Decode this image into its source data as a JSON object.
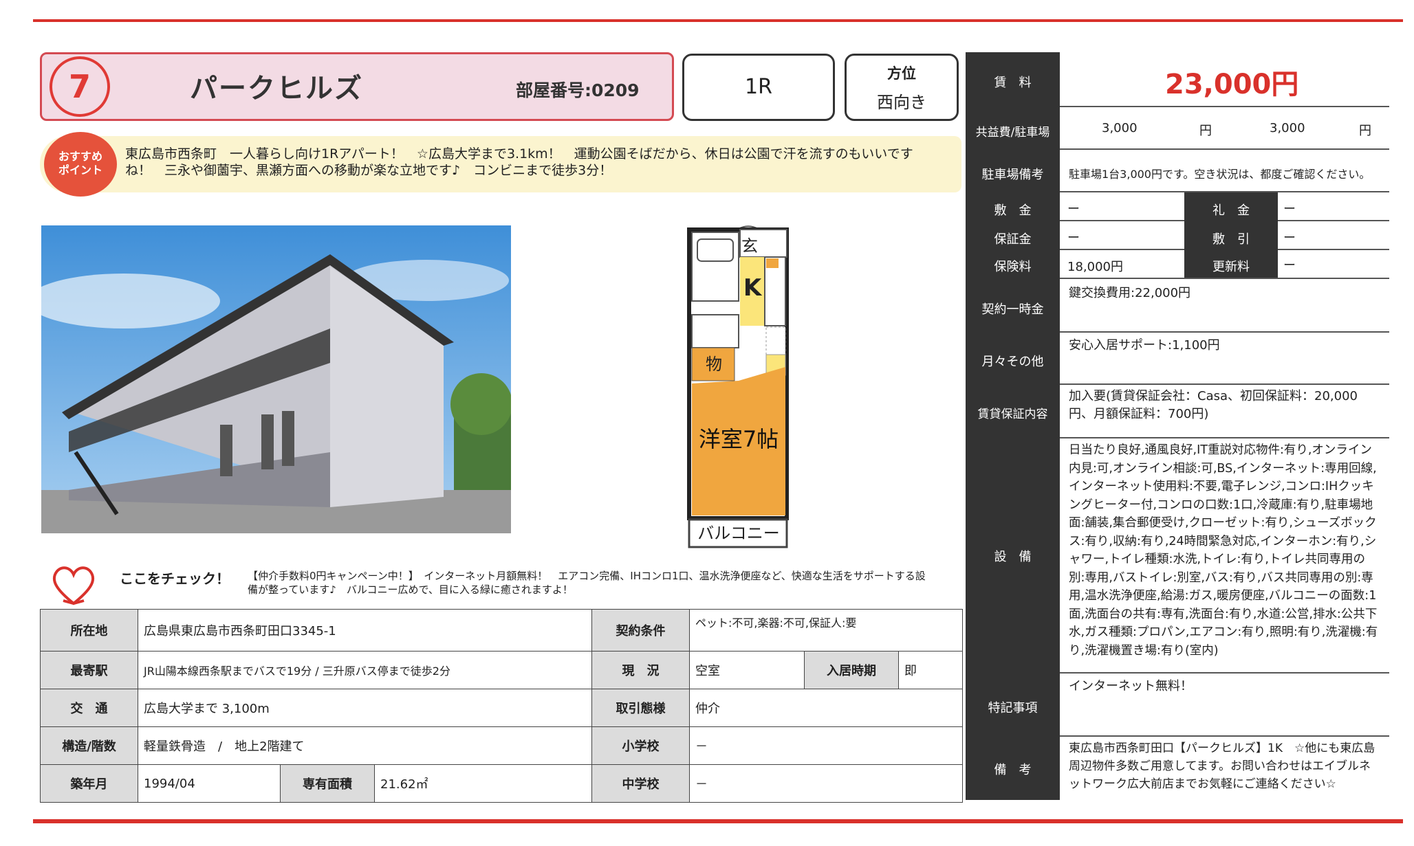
{
  "header": {
    "number": "7",
    "property_name": "パークヒルズ",
    "room_number_label": "部屋番号:0209",
    "layout": "1R",
    "direction_label": "方位",
    "direction_value": "西向き"
  },
  "recommend": {
    "badge_line1": "おすすめ",
    "badge_line2": "ポイント",
    "text": "東広島市西条町　一人暮らし向け1Rアパート！　☆広島大学まで3.1km！　運動公園そばだから、休日は公園で汗を流すのもいいですね！　三永や御薗宇、黒瀬方面への移動が楽な立地です♪　コンビニまで徒歩3分！"
  },
  "floor_plan": {
    "genkan": "玄",
    "kitchen": "K",
    "storage": "物",
    "room": "洋室7帖",
    "balcony": "バルコニー"
  },
  "check": {
    "heading": "ここをチェック！",
    "text": "【仲介手数料0円キャンペーン中！】　インターネット月額無料！　エアコン完備、IHコンロ1口、温水洗浄便座など、快適な生活をサポートする設備が整っています♪　バルコニー広めで、目に入る緑に癒されますよ！"
  },
  "info": {
    "address_label": "所在地",
    "address": "広島県東広島市西条町田口3345-1",
    "contract_label": "契約条件",
    "contract": "ペット:不可,楽器:不可,保証人:要",
    "station_label": "最寄駅",
    "station": "JR山陽本線西条駅までバスで19分 / 三升原バス停まで徒歩2分",
    "status_label": "現　況",
    "status": "空室",
    "movein_label": "入居時期",
    "movein": "即",
    "transport_label": "交　通",
    "transport": "広島大学まで 3,100m",
    "deal_label": "取引態様",
    "deal": "仲介",
    "structure_label": "構造/階数",
    "structure": "軽量鉄骨造　/　地上2階建て",
    "elementary_label": "小学校",
    "elementary": "－",
    "built_label": "築年月",
    "built": "1994/04",
    "area_label": "専有面積",
    "area": "21.62㎡",
    "junior_label": "中学校",
    "junior": "－"
  },
  "fees": {
    "rent_label": "賃　料",
    "rent": "23,000円",
    "common_label": "共益費/駐車場",
    "common": "3,000",
    "yen1": "円",
    "parking": "3,000",
    "yen2": "円",
    "parking_note_label": "駐車場備考",
    "parking_note": "駐車場1台3,000円です。空き状況は、都度ご確認ください。",
    "deposit_label": "敷　金",
    "deposit": "ー",
    "key_money_label": "礼　金",
    "key_money": "ー",
    "guarantee_label": "保証金",
    "guarantee": "ー",
    "deduction_label": "敷　引",
    "deduction": "ー",
    "insurance_label": "保険料",
    "insurance": "18,000円",
    "renewal_label": "更新料",
    "renewal": "ー",
    "onetime_label": "契約一時金",
    "onetime": "鍵交換費用:22,000円",
    "monthly_label": "月々その他",
    "monthly": "安心入居サポート:1,100円",
    "guarantor_label": "賃貸保証内容",
    "guarantor": "加入要(賃貸保証会社：Casa、初回保証料：20,000円、月額保証料：700円)",
    "equipment_label": "設　備",
    "equipment": "日当たり良好,通風良好,IT重説対応物件:有り,オンライン内見:可,オンライン相談:可,BS,インターネット:専用回線,インターネット使用料:不要,電子レンジ,コンロ:IHクッキングヒーター付,コンロの口数:1口,冷蔵庫:有り,駐車場地面:舗装,集合郵便受け,クローゼット:有り,シューズボックス:有り,収納:有り,24時間緊急対応,インターホン:有り,シャワー,トイレ種類:水洗,トイレ:有り,トイレ共同専用の別:専用,バストイレ:別室,バス:有り,バス共同専用の別:専用,温水洗浄便座,給湯:ガス,暖房便座,バルコニーの面数:1面,洗面台の共有:専有,洗面台:有り,水道:公営,排水:公共下水,ガス種類:プロパン,エアコン:有り,照明:有り,洗濯機:有り,洗濯機置き場:有り(室内)",
    "special_label": "特記事項",
    "special": "インターネット無料！",
    "remarks_label": "備　考",
    "remarks": "東広島市西条町田口【パークヒルズ】1K　☆他にも東広島周辺物件多数ご用意してます。お問い合わせはエイブルネットワーク広大前店までお気軽にご連絡ください☆"
  }
}
